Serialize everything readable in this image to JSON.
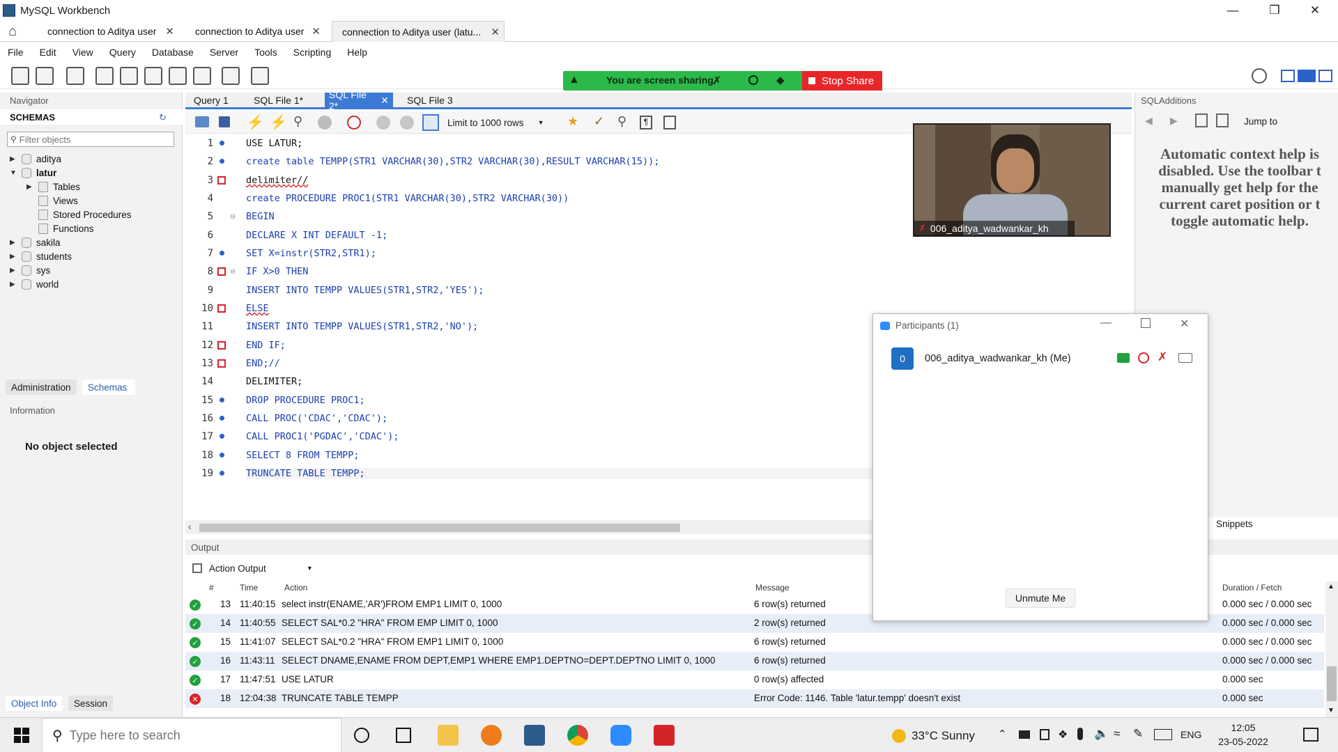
{
  "window": {
    "title": "MySQL Workbench"
  },
  "conn_tabs": [
    {
      "label": "connection to Aditya user"
    },
    {
      "label": "connection to Aditya user"
    },
    {
      "label": "connection to Aditya user (latu..."
    }
  ],
  "menu": [
    "File",
    "Edit",
    "View",
    "Query",
    "Database",
    "Server",
    "Tools",
    "Scripting",
    "Help"
  ],
  "share": {
    "text": "You are screen sharing",
    "stop_label": "Stop Share"
  },
  "navigator": {
    "title": "Navigator",
    "schemas_label": "SCHEMAS",
    "filter_placeholder": "Filter objects",
    "schemas": [
      "aditya",
      "latur",
      "sakila",
      "students",
      "sys",
      "world"
    ],
    "latur_children": [
      "Tables",
      "Views",
      "Stored Procedures",
      "Functions"
    ],
    "tabs": {
      "administration": "Administration",
      "schemas": "Schemas"
    },
    "information_label": "Information",
    "no_object": "No object selected",
    "bottom_tabs": {
      "object_info": "Object Info",
      "session": "Session"
    }
  },
  "editor": {
    "tabs": [
      "Query 1",
      "SQL File 1*",
      "SQL File 2*",
      "SQL File 3"
    ],
    "limit_label": "Limit to 1000 rows",
    "lines": [
      "USE LATUR;",
      "create table TEMPP(STR1 VARCHAR(30),STR2 VARCHAR(30),RESULT VARCHAR(15));",
      "delimiter//",
      "create PROCEDURE PROC1(STR1 VARCHAR(30),STR2 VARCHAR(30))",
      "BEGIN",
      "DECLARE X INT DEFAULT -1;",
      "SET X=instr(STR2,STR1);",
      "IF X>0 THEN",
      "INSERT INTO TEMPP VALUES(STR1,STR2,'YES');",
      "ELSE",
      "INSERT INTO TEMPP VALUES(STR1,STR2,'NO');",
      "END IF;",
      "END;//",
      "DELIMITER;",
      "DROP PROCEDURE PROC1;",
      "CALL PROC('CDAC','CDAC');",
      "CALL PROC1('PGDAC','CDAC');",
      "SELECT 8 FROM TEMPP;",
      "TRUNCATE TABLE TEMPP;"
    ],
    "line_numbers": [
      "1",
      "2",
      "3",
      "4",
      "5",
      "6",
      "7",
      "8",
      "9",
      "10",
      "11",
      "12",
      "13",
      "14",
      "15",
      "16",
      "17",
      "18",
      "19"
    ]
  },
  "sql_additions": {
    "title": "SQLAdditions",
    "jump_to": "Jump to",
    "help": "Automatic context help is disabled. Use the toolbar t manually get help for the current caret position or t toggle automatic help.",
    "snippets": "Snippets"
  },
  "output": {
    "title": "Output",
    "selector": "Action Output",
    "columns": [
      "#",
      "Time",
      "Action",
      "Message",
      "Duration / Fetch"
    ],
    "rows": [
      {
        "n": "13",
        "time": "11:40:15",
        "action": "select instr(ENAME,'AR')FROM EMP1 LIMIT 0, 1000",
        "message": "6 row(s) returned",
        "duration": "0.000 sec / 0.000 sec",
        "status": "ok"
      },
      {
        "n": "14",
        "time": "11:40:55",
        "action": "SELECT SAL*0.2 \"HRA\" FROM EMP LIMIT 0, 1000",
        "message": "2 row(s) returned",
        "duration": "0.000 sec / 0.000 sec",
        "status": "ok"
      },
      {
        "n": "15",
        "time": "11:41:07",
        "action": "SELECT SAL*0.2 \"HRA\" FROM EMP1 LIMIT 0, 1000",
        "message": "6 row(s) returned",
        "duration": "0.000 sec / 0.000 sec",
        "status": "ok"
      },
      {
        "n": "16",
        "time": "11:43:11",
        "action": "SELECT DNAME,ENAME FROM DEPT,EMP1 WHERE EMP1.DEPTNO=DEPT.DEPTNO LIMIT 0, 1000",
        "message": "6 row(s) returned",
        "duration": "0.000 sec / 0.000 sec",
        "status": "ok"
      },
      {
        "n": "17",
        "time": "11:47:51",
        "action": "USE LATUR",
        "message": "0 row(s) affected",
        "duration": "0.000 sec",
        "status": "ok"
      },
      {
        "n": "18",
        "time": "12:04:38",
        "action": "TRUNCATE TABLE TEMPP",
        "message": "Error Code: 1146. Table 'latur.tempp' doesn't exist",
        "duration": "0.000 sec",
        "status": "error"
      }
    ]
  },
  "video": {
    "name": "006_aditya_wadwankar_kh"
  },
  "participants": {
    "title": "Participants (1)",
    "avatar_letter": "0",
    "name": "006_aditya_wadwankar_kh (Me)",
    "unmute_label": "Unmute Me"
  },
  "taskbar": {
    "search_placeholder": "Type here to search",
    "weather": "33°C  Sunny",
    "lang": "ENG",
    "time": "12:05",
    "date": "23-05-2022"
  }
}
